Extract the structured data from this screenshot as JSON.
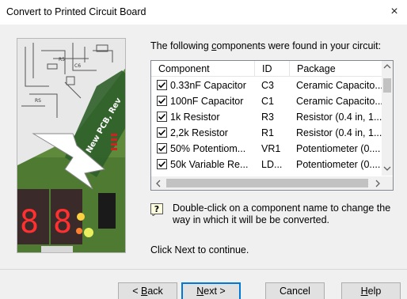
{
  "window": {
    "title": "Convert to Printed Circuit Board",
    "close_glyph": "×"
  },
  "intro": {
    "text_before": "The following ",
    "text_underlined": "c",
    "text_after": "omponents were found in your circuit:"
  },
  "table": {
    "columns": [
      "Component",
      "ID",
      "Package"
    ],
    "rows": [
      {
        "checked": true,
        "component": "0.33nF Capacitor",
        "id": "C3",
        "package": "Ceramic Capacito..."
      },
      {
        "checked": true,
        "component": "100nF Capacitor",
        "id": "C1",
        "package": "Ceramic Capacito..."
      },
      {
        "checked": true,
        "component": "1k Resistor",
        "id": "R3",
        "package": "Resistor (0.4 in, 1..."
      },
      {
        "checked": true,
        "component": "2,2k Resistor",
        "id": "R1",
        "package": "Resistor (0.4 in, 1..."
      },
      {
        "checked": true,
        "component": "50% Potentiom...",
        "id": "VR1",
        "package": "Potentiometer (0...."
      },
      {
        "checked": true,
        "component": "50k Variable Re...",
        "id": "LD...",
        "package": "Potentiometer (0...."
      }
    ]
  },
  "hint": {
    "icon": "question-mark-icon",
    "text": "Double-click on a component name to change the way in which it will be be converted."
  },
  "next_instruction": "Click Next to continue.",
  "buttons": {
    "back": {
      "pre": "< ",
      "underline": "B",
      "post": "ack"
    },
    "next": {
      "underline": "N",
      "post": "ext >"
    },
    "cancel": "Cancel",
    "help": {
      "underline": "H",
      "post": "elp"
    }
  },
  "image": {
    "label": "PCB",
    "overlay_text": "New PCB, Rev"
  },
  "colors": {
    "accent": "#0078d7",
    "background": "#f0f0f0"
  }
}
